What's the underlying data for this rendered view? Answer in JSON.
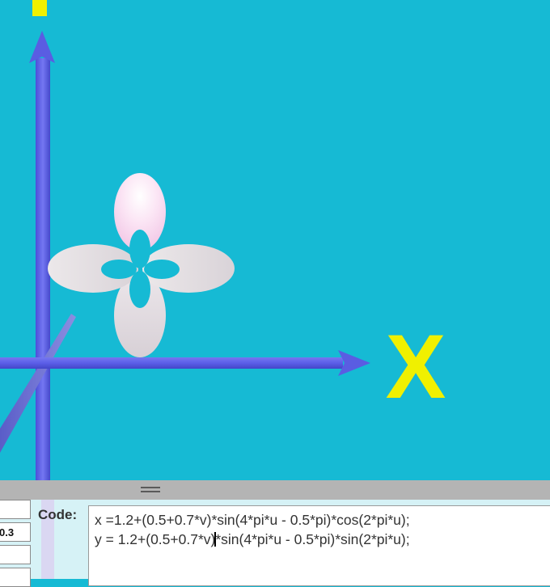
{
  "scene": {
    "background": "#16bad4",
    "axis_color": "#5b5ee8",
    "axis_label_color": "#f0f000",
    "x_axis_label": "X",
    "surface_color": "#e7e1e6",
    "surface_highlight": "#fbd6f0"
  },
  "panel": {
    "param_values": [
      "",
      "0.3",
      "",
      ""
    ],
    "code_label": "Code:",
    "code_lines": [
      "x =1.2+(0.5+0.7*v)*sin(4*pi*u - 0.5*pi)*cos(2*pi*u);",
      "y = 1.2+(0.5+0.7*v)",
      "*sin(4*pi*u - 0.5*pi)*sin(2*pi*u);"
    ]
  }
}
